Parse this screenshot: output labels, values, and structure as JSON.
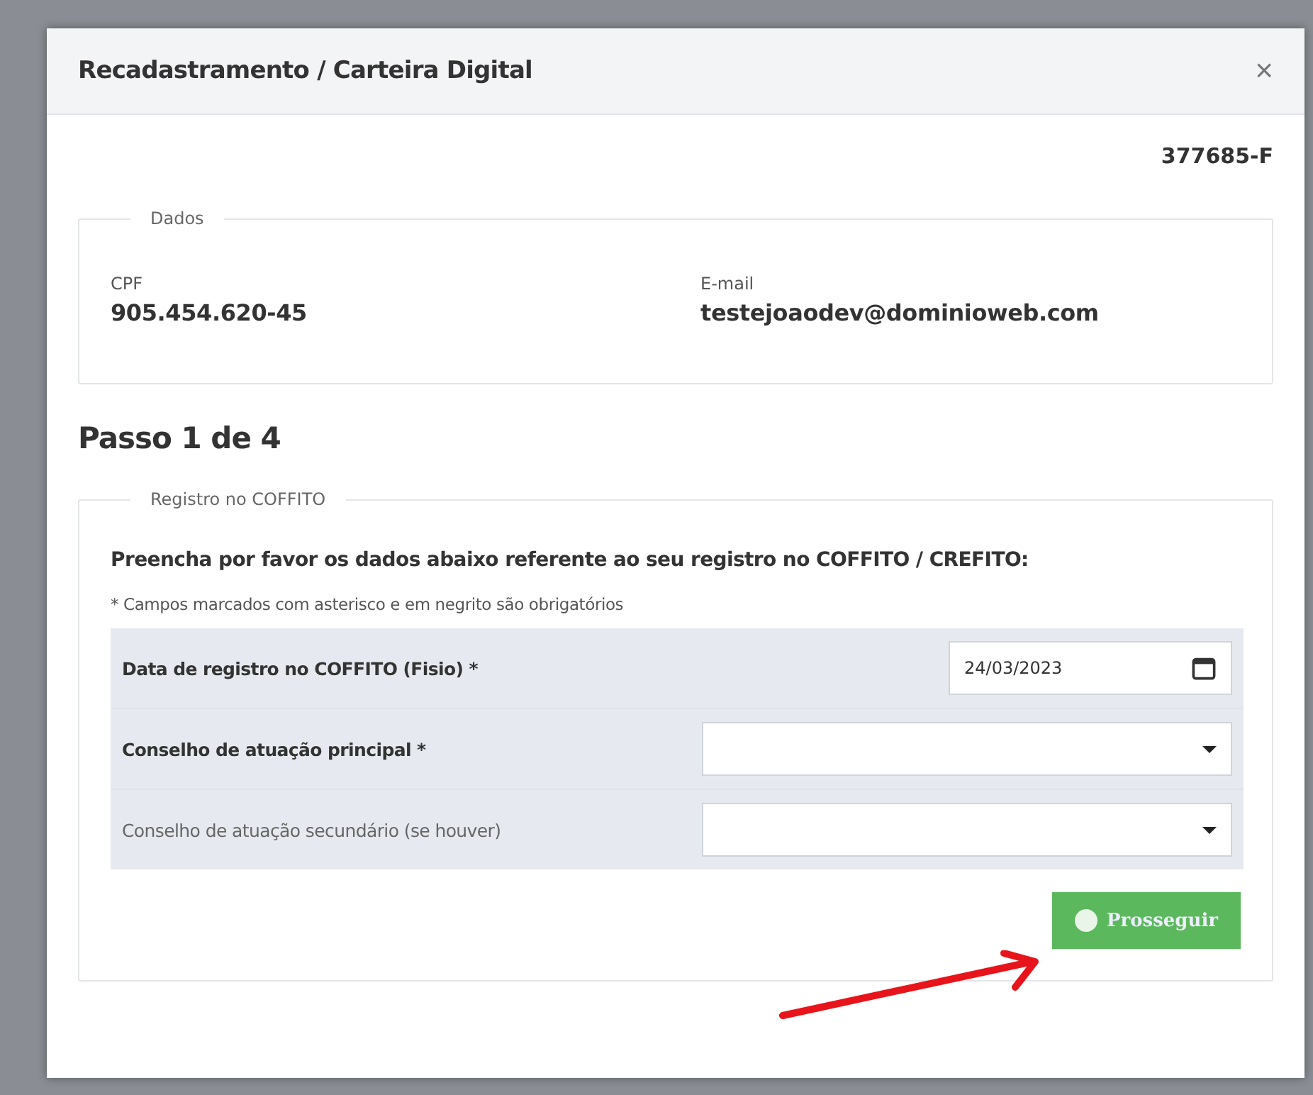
{
  "modal": {
    "title": "Recadastramento / Carteira Digital",
    "close": "×",
    "code": "377685-F",
    "dados": {
      "legend": "Dados",
      "fields": [
        {
          "label": "CPF",
          "value": "905.454.620-45"
        },
        {
          "label": "E-mail",
          "value": "testejoaodev@dominioweb.com"
        }
      ]
    },
    "step": "Passo 1 de 4",
    "registro": {
      "legend": "Registro no COFFITO",
      "instruction": "Preencha por favor os dados abaixo referente ao seu registro no COFFITO / CREFITO:",
      "note": "* Campos marcados com asterisco e em negrito são obrigatórios",
      "fields": [
        {
          "kind": "date",
          "label": "Data de registro no COFFITO (Fisio) *",
          "required": true,
          "value": "24/03/2023"
        },
        {
          "kind": "select",
          "label": "Conselho de atuação principal *",
          "required": true
        },
        {
          "kind": "select",
          "label": "Conselho de atuação secundário (se houver)",
          "required": false
        }
      ]
    },
    "button": "Prosseguir"
  }
}
